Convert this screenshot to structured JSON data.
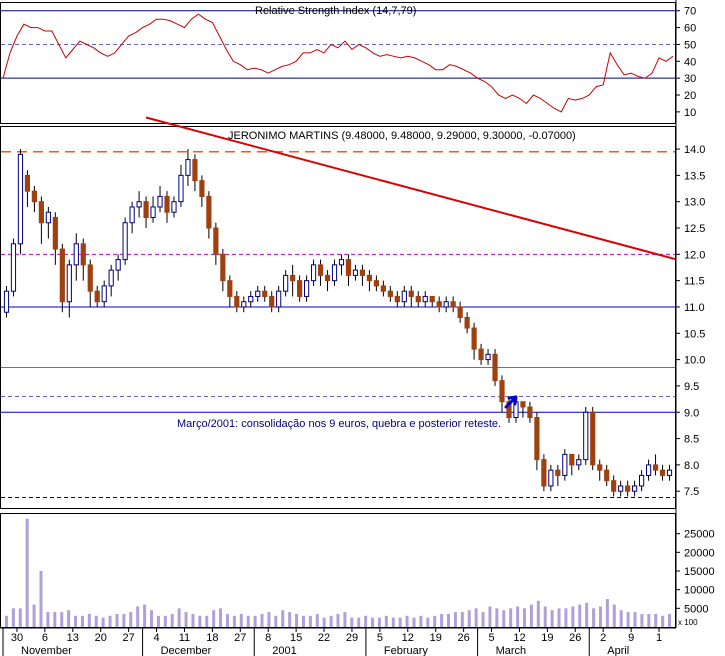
{
  "chart_data": [
    {
      "panel": "rsi",
      "type": "line",
      "title": "Relative Strength Index (14,7,79)",
      "y_ticks": [
        10,
        20,
        30,
        40,
        50,
        60,
        70
      ],
      "ylim": [
        4,
        74
      ],
      "reference_lines": [
        30,
        50,
        70
      ],
      "line_color": "#cc0000",
      "values": [
        30,
        45,
        55,
        62,
        60,
        60,
        58,
        58,
        50,
        42,
        47,
        52,
        50,
        48,
        45,
        43,
        45,
        50,
        55,
        57,
        60,
        62,
        65,
        65,
        64,
        62,
        60,
        65,
        68,
        65,
        63,
        55,
        47,
        40,
        38,
        35,
        36,
        35,
        33,
        35,
        37,
        38,
        40,
        45,
        45,
        47,
        45,
        50,
        48,
        52,
        47,
        50,
        48,
        45,
        43,
        44,
        43,
        42,
        43,
        42,
        40,
        38,
        35,
        35,
        38,
        37,
        35,
        33,
        30,
        28,
        25,
        20,
        18,
        20,
        18,
        15,
        20,
        18,
        15,
        12,
        10,
        18,
        17,
        18,
        20,
        25,
        26,
        45,
        38,
        32,
        33,
        31,
        30,
        33,
        42,
        40,
        43
      ]
    },
    {
      "panel": "price",
      "type": "candlestick",
      "title": "JERONIMO MARTINS (9.48000, 9.48000, 9.29000, 9.30000, -0.07000)",
      "y_ticks": [
        7.5,
        8.0,
        8.5,
        9.0,
        9.5,
        10.0,
        10.5,
        11.0,
        11.5,
        12.0,
        12.5,
        13.0,
        13.5,
        14.0
      ],
      "ylim": [
        7.2,
        14.4
      ],
      "up_color": "#ffffff",
      "down_color": "#a0400f",
      "support_lines": [
        {
          "value": 11.0,
          "style": "solid",
          "color": "#0000cc"
        },
        {
          "value": 9.85,
          "style": "solid",
          "color": "#6666cc"
        },
        {
          "value": 9.3,
          "style": "dashed",
          "color": "#6666cc"
        },
        {
          "value": 9.0,
          "style": "solid",
          "color": "#0000cc"
        },
        {
          "value": 7.38,
          "style": "dashed",
          "color": "#000080"
        },
        {
          "value": 13.95,
          "style": "dashed",
          "color": "#e06020"
        },
        {
          "value": 12.0,
          "style": "dashed",
          "color": "#cc00cc"
        }
      ],
      "trendline": {
        "from_index": 20,
        "from_value": 14.6,
        "to_index": 113,
        "to_value": 11.3,
        "color": "#dd0000"
      },
      "annotation": "Março/2001: consolidação nos 9 euros, quebra e posterior reteste.",
      "candles": [
        [
          10.9,
          11.3,
          10.8,
          11.4
        ],
        [
          11.3,
          12.2,
          11.2,
          12.3
        ],
        [
          12.2,
          13.9,
          12.0,
          14.0
        ],
        [
          13.5,
          13.2,
          12.9,
          13.6
        ],
        [
          13.2,
          13.0,
          12.8,
          13.3
        ],
        [
          13.0,
          12.6,
          12.2,
          13.1
        ],
        [
          12.6,
          12.8,
          12.3,
          12.9
        ],
        [
          12.7,
          12.1,
          11.8,
          12.8
        ],
        [
          12.1,
          11.1,
          10.9,
          12.2
        ],
        [
          11.1,
          11.8,
          10.8,
          11.9
        ],
        [
          11.8,
          12.2,
          11.5,
          12.4
        ],
        [
          12.2,
          11.8,
          11.5,
          12.3
        ],
        [
          11.8,
          11.3,
          11.0,
          11.9
        ],
        [
          11.3,
          11.1,
          11.0,
          11.4
        ],
        [
          11.1,
          11.4,
          11.0,
          11.5
        ],
        [
          11.4,
          11.7,
          11.2,
          11.8
        ],
        [
          11.7,
          11.9,
          11.5,
          12.0
        ],
        [
          11.9,
          12.6,
          11.8,
          12.7
        ],
        [
          12.6,
          12.9,
          12.4,
          13.0
        ],
        [
          12.9,
          13.0,
          12.7,
          13.2
        ],
        [
          13.0,
          12.7,
          12.5,
          13.1
        ],
        [
          12.7,
          12.9,
          12.6,
          13.1
        ],
        [
          12.9,
          13.1,
          12.8,
          13.3
        ],
        [
          13.1,
          12.8,
          12.6,
          13.2
        ],
        [
          12.8,
          13.0,
          12.7,
          13.1
        ],
        [
          13.0,
          13.5,
          12.9,
          13.7
        ],
        [
          13.5,
          13.8,
          13.3,
          14.0
        ],
        [
          13.8,
          13.4,
          13.2,
          13.9
        ],
        [
          13.4,
          13.1,
          12.9,
          13.5
        ],
        [
          13.1,
          12.5,
          12.3,
          13.2
        ],
        [
          12.5,
          12.0,
          11.8,
          12.6
        ],
        [
          12.0,
          11.5,
          11.3,
          12.1
        ],
        [
          11.5,
          11.2,
          11.0,
          11.6
        ],
        [
          11.2,
          11.0,
          10.9,
          11.3
        ],
        [
          11.0,
          11.1,
          10.9,
          11.2
        ],
        [
          11.1,
          11.2,
          11.0,
          11.3
        ],
        [
          11.2,
          11.3,
          11.1,
          11.4
        ],
        [
          11.3,
          11.2,
          11.1,
          11.4
        ],
        [
          11.2,
          11.0,
          10.9,
          11.3
        ],
        [
          11.0,
          11.3,
          10.9,
          11.4
        ],
        [
          11.3,
          11.6,
          11.2,
          11.7
        ],
        [
          11.6,
          11.5,
          11.2,
          11.8
        ],
        [
          11.5,
          11.2,
          11.1,
          11.6
        ],
        [
          11.2,
          11.5,
          11.1,
          11.6
        ],
        [
          11.5,
          11.8,
          11.4,
          11.9
        ],
        [
          11.8,
          11.6,
          11.4,
          11.9
        ],
        [
          11.6,
          11.5,
          11.3,
          11.7
        ],
        [
          11.5,
          11.8,
          11.4,
          11.9
        ],
        [
          11.8,
          11.9,
          11.6,
          12.0
        ],
        [
          11.9,
          11.6,
          11.4,
          12.0
        ],
        [
          11.6,
          11.7,
          11.5,
          11.8
        ],
        [
          11.7,
          11.6,
          11.4,
          11.8
        ],
        [
          11.6,
          11.5,
          11.3,
          11.7
        ],
        [
          11.5,
          11.4,
          11.3,
          11.6
        ],
        [
          11.4,
          11.3,
          11.2,
          11.5
        ],
        [
          11.3,
          11.2,
          11.1,
          11.4
        ],
        [
          11.2,
          11.1,
          11.0,
          11.3
        ],
        [
          11.1,
          11.3,
          11.0,
          11.4
        ],
        [
          11.3,
          11.2,
          11.0,
          11.4
        ],
        [
          11.2,
          11.1,
          11.0,
          11.3
        ],
        [
          11.1,
          11.2,
          11.0,
          11.3
        ],
        [
          11.2,
          11.1,
          11.0,
          11.2
        ],
        [
          11.1,
          11.0,
          10.9,
          11.2
        ],
        [
          11.0,
          11.1,
          10.9,
          11.2
        ],
        [
          11.1,
          11.0,
          10.9,
          11.2
        ],
        [
          11.0,
          10.8,
          10.7,
          11.1
        ],
        [
          10.8,
          10.6,
          10.5,
          10.9
        ],
        [
          10.6,
          10.2,
          10.0,
          10.7
        ],
        [
          10.2,
          10.0,
          9.9,
          10.3
        ],
        [
          10.0,
          10.1,
          9.9,
          10.2
        ],
        [
          10.1,
          9.6,
          9.5,
          10.2
        ],
        [
          9.6,
          9.2,
          9.0,
          9.7
        ],
        [
          9.2,
          8.9,
          8.8,
          9.3
        ],
        [
          8.9,
          9.2,
          8.8,
          9.3
        ],
        [
          9.2,
          9.1,
          8.9,
          9.2
        ],
        [
          9.1,
          8.9,
          8.8,
          9.2
        ],
        [
          8.9,
          8.1,
          7.9,
          9.0
        ],
        [
          8.1,
          7.6,
          7.5,
          8.2
        ],
        [
          7.6,
          7.9,
          7.5,
          8.0
        ],
        [
          7.9,
          7.8,
          7.6,
          8.0
        ],
        [
          7.8,
          8.2,
          7.7,
          8.3
        ],
        [
          8.2,
          8.0,
          7.8,
          8.2
        ],
        [
          8.0,
          8.1,
          7.9,
          8.2
        ],
        [
          8.1,
          9.0,
          8.0,
          9.1
        ],
        [
          9.0,
          8.0,
          7.9,
          9.1
        ],
        [
          8.0,
          7.9,
          7.7,
          8.1
        ],
        [
          7.9,
          7.7,
          7.6,
          8.0
        ],
        [
          7.7,
          7.5,
          7.4,
          7.8
        ],
        [
          7.5,
          7.6,
          7.4,
          7.7
        ],
        [
          7.6,
          7.5,
          7.4,
          7.7
        ],
        [
          7.5,
          7.6,
          7.4,
          7.7
        ],
        [
          7.6,
          7.8,
          7.5,
          7.9
        ],
        [
          7.8,
          8.0,
          7.7,
          8.1
        ],
        [
          8.0,
          7.9,
          7.8,
          8.2
        ],
        [
          7.9,
          7.8,
          7.7,
          8.0
        ],
        [
          7.8,
          7.9,
          7.7,
          8.0
        ]
      ]
    },
    {
      "panel": "volume",
      "type": "bar",
      "y_ticks": [
        5000,
        10000,
        15000,
        20000,
        25000
      ],
      "scale_note": "x 100",
      "ylim": [
        0,
        30000
      ],
      "bar_color": "#b0a0d8",
      "values": [
        3000,
        5000,
        5000,
        29000,
        6000,
        15000,
        4000,
        4000,
        4000,
        4500,
        3000,
        3000,
        3500,
        3000,
        2500,
        3000,
        3500,
        3500,
        4000,
        5500,
        6000,
        4500,
        3000,
        3000,
        3500,
        5000,
        4000,
        3500,
        3000,
        3000,
        4500,
        5000,
        3500,
        3000,
        3500,
        3000,
        3000,
        3500,
        4000,
        3000,
        4500,
        4000,
        3500,
        3000,
        3000,
        3500,
        2500,
        3000,
        3500,
        4000,
        2500,
        2500,
        3000,
        2500,
        2500,
        3000,
        2500,
        2500,
        3000,
        2500,
        3000,
        2500,
        3000,
        3500,
        3500,
        4000,
        4000,
        4500,
        5000,
        4000,
        5500,
        5000,
        4500,
        5000,
        5500,
        5000,
        6000,
        7000,
        5500,
        4500,
        5000,
        5000,
        5500,
        6000,
        6500,
        5000,
        5500,
        7500,
        6000,
        4500,
        4000,
        4000,
        3500,
        3500,
        3500,
        3000,
        3500
      ],
      "x_tick_labels": [
        "30",
        "6",
        "13",
        "20",
        "27",
        "4",
        "11",
        "18",
        "27",
        "8",
        "15",
        "22",
        "29",
        "5",
        "12",
        "19",
        "26",
        "5",
        "12",
        "19",
        "26",
        "2",
        "9",
        "1"
      ],
      "month_labels": [
        "November",
        "December",
        "2001",
        "February",
        "March",
        "April"
      ]
    }
  ]
}
